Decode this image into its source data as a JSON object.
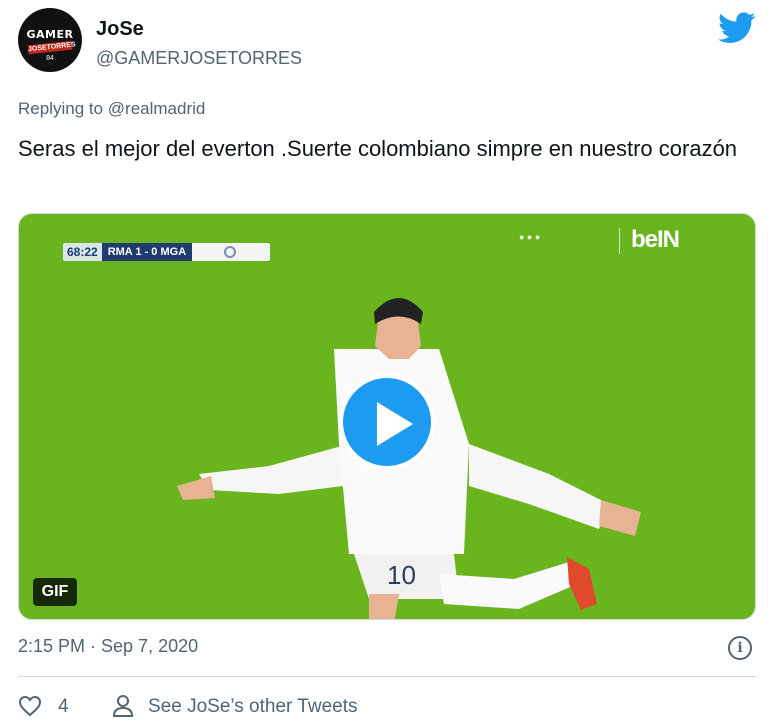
{
  "author": {
    "avatar_line1": "GAMER",
    "avatar_line2": "JOSETORRES",
    "avatar_line3": "84",
    "name": "JoSe",
    "handle": "@GAMERJOSETORRES"
  },
  "tweet": {
    "replying_to": "Replying to @realmadrid",
    "text": "Seras el mejor del everton .Suerte colombiano simpre en nuestro corazón",
    "timestamp": "2:15 PM · Sep 7, 2020"
  },
  "media": {
    "badge": "GIF",
    "scoreboard_clock": "68:22",
    "scoreboard_teams": "RMA 1 - 0 MGA",
    "broadcaster": "beIN",
    "shirt_number": "10"
  },
  "actions": {
    "like_count": "4",
    "see_more": "See JoSe’s other Tweets"
  },
  "colors": {
    "accent": "#1d9bf0",
    "muted_text": "#536471",
    "pitch": "#6ab51d"
  },
  "icons": [
    "twitter-bird-icon",
    "play-icon",
    "info-icon",
    "heart-icon",
    "person-icon"
  ]
}
